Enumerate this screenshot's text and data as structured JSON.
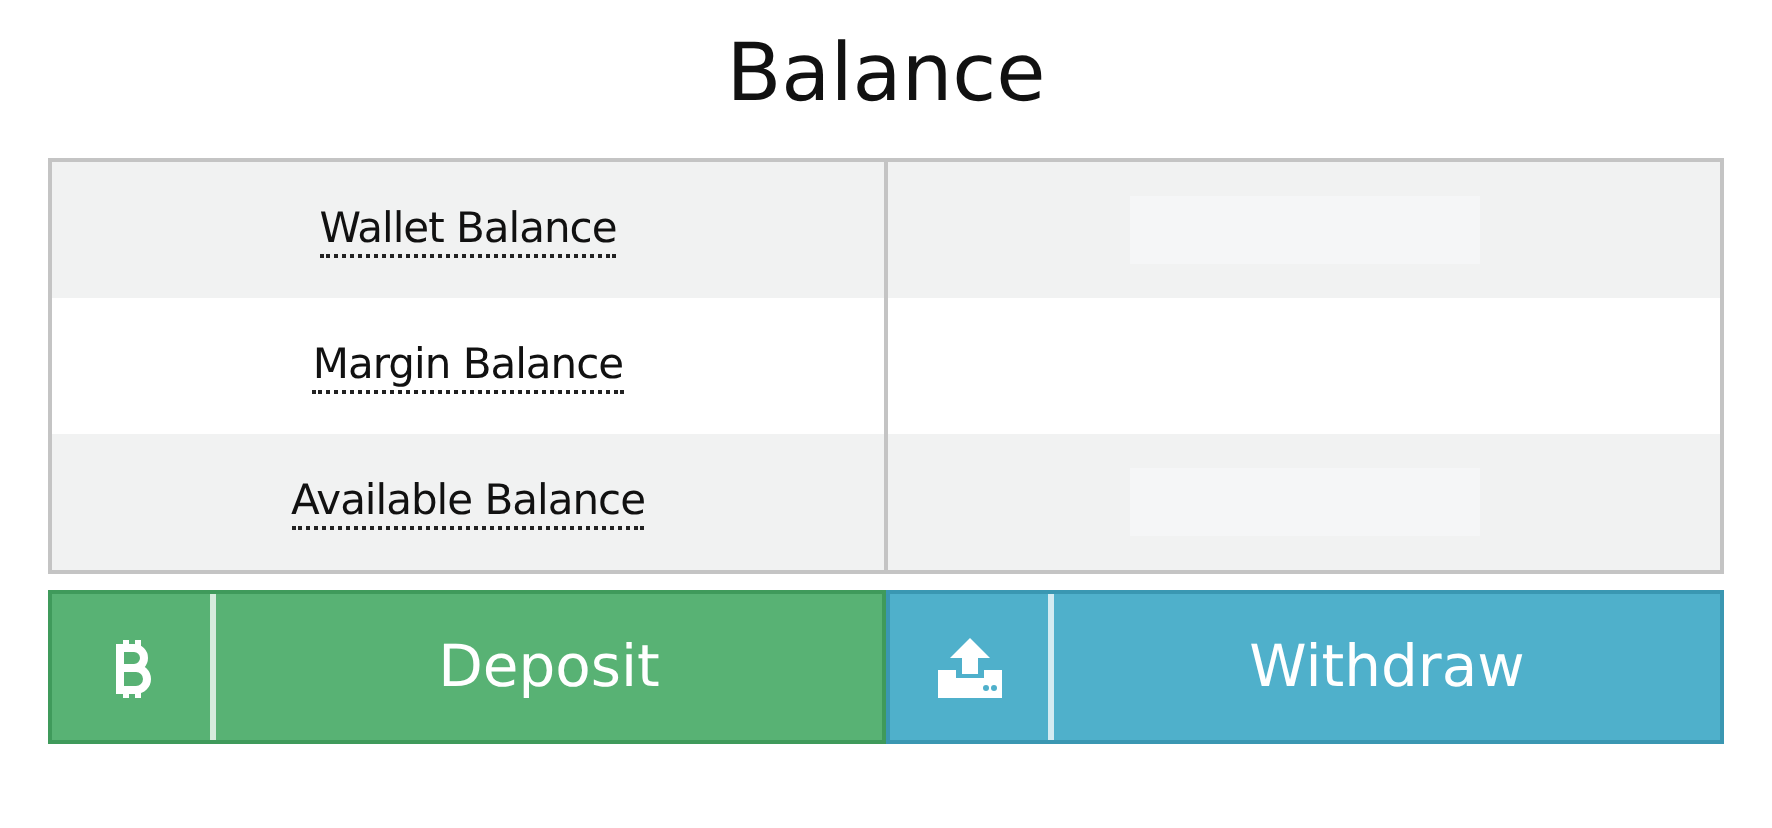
{
  "title": "Balance",
  "rows": [
    {
      "label": "Wallet Balance",
      "loading": true
    },
    {
      "label": "Margin Balance",
      "loading": false
    },
    {
      "label": "Available Balance",
      "loading": true
    }
  ],
  "buttons": [
    {
      "kind": "deposit",
      "label": "Deposit"
    },
    {
      "kind": "withdraw",
      "label": "Withdraw"
    }
  ]
}
